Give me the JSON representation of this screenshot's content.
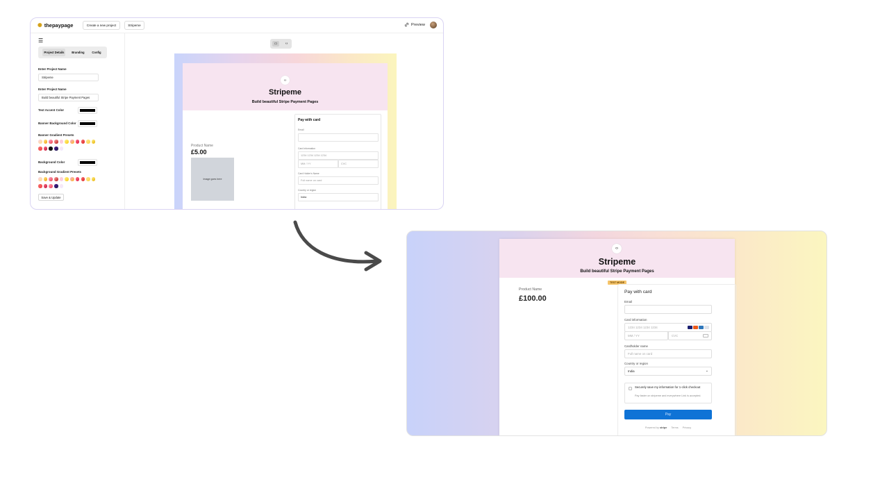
{
  "editor": {
    "logo": "thepaypage",
    "create_btn": "Create a new project",
    "project_btn": "Stripeme",
    "preview": "Preview",
    "tabs": [
      "Project Details",
      "Branding",
      "Config"
    ],
    "fields": {
      "project_name_label": "Enter Project Name",
      "project_name_value": "Stripeme",
      "project_desc_label": "Enter Project Name",
      "project_desc_value": "Build beautiful Stripe Payment Pages",
      "text_accent_label": "Text Accent Color",
      "banner_bg_label": "Banner Background Color",
      "banner_presets_label": "Banner Gradient Presets",
      "bg_color_label": "Background Color",
      "bg_presets_label": "Background Gradient Presets"
    },
    "save_btn": "Save & Update",
    "preview_page": {
      "title": "Stripeme",
      "subtitle": "Build beautiful Stripe Payment Pages",
      "product_name": "Product Name",
      "price": "£5.00",
      "image_placeholder": "Image goes here",
      "form_title": "Pay with card",
      "email_label": "Email",
      "card_label": "Card information",
      "card_placeholder": "1234 1234 1234 1234",
      "expiry_placeholder": "MM / YY",
      "cvc_placeholder": "CVC",
      "holder_label": "Card Holder's Name",
      "holder_placeholder": "Full name on card",
      "country_label": "Country or region",
      "country_value": "India"
    }
  },
  "live": {
    "title": "Stripeme",
    "subtitle": "Build beautiful Stripe Payment Pages",
    "test_mode": "TEST MODE",
    "product_name": "Product Name",
    "price": "£100.00",
    "form_title": "Pay with card",
    "email_label": "Email",
    "card_label": "Card information",
    "card_placeholder": "1234 1234 1234 1234",
    "expiry_placeholder": "MM / YY",
    "cvc_placeholder": "CVC",
    "holder_label": "Cardholder name",
    "holder_placeholder": "Full name on card",
    "country_label": "Country or region",
    "country_value": "India",
    "save_title": "Securely save my information for 1-click checkout",
    "save_sub": "Pay faster on stripeme and everywhere Link is accepted.",
    "pay_btn": "Pay",
    "powered_by": "Powered by",
    "stripe": "stripe",
    "terms": "Terms",
    "privacy": "Privacy"
  },
  "colors": {
    "accent_blue": "#0f73d6",
    "banner_pink": "#f7e4f0",
    "swatch_black": "#000000"
  }
}
